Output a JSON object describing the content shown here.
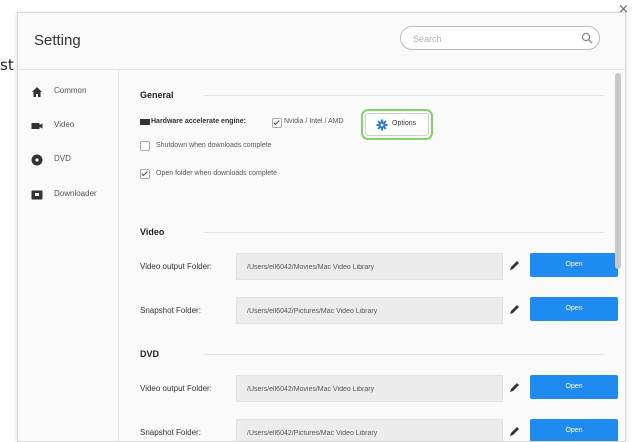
{
  "background": {
    "partial_text": "st"
  },
  "close_glyph": "×",
  "window": {
    "title": "Setting",
    "search": {
      "placeholder": "Search",
      "value": ""
    }
  },
  "sidebar": {
    "items": [
      {
        "label": "Common",
        "icon": "home-icon",
        "selected": true
      },
      {
        "label": "Video",
        "icon": "video-camera-icon",
        "selected": false
      },
      {
        "label": "DVD",
        "icon": "disc-icon",
        "selected": false
      },
      {
        "label": "Downloader",
        "icon": "download-icon",
        "selected": false
      }
    ]
  },
  "general": {
    "title": "General",
    "hw_label": "Hardware accelerate engine:",
    "hw_option": "Nvidia / Intel / AMD",
    "hw_checked": true,
    "options_label": "Options",
    "shutdown_label": "Shutdown when downloads complete",
    "shutdown_checked": false,
    "open_folder_label": "Open folder when downloads complete",
    "open_folder_checked": true
  },
  "video": {
    "title": "Video",
    "output_label": "Video output Folder:",
    "output_path": "/Users/ell6042/Movies/Mac Video Library",
    "snapshot_label": "Snapshot Folder:",
    "snapshot_path": "/Users/ell6042/Pictures/Mac Video Library",
    "open_label": "Open"
  },
  "dvd": {
    "title": "DVD",
    "output_label": "Video output Folder:",
    "output_path": "/Users/ell6042/Movies/Mac Video Library",
    "snapshot_label": "Snapshot Folder:",
    "snapshot_path": "/Users/ell6042/Pictures/Mac Video Library",
    "open_label": "Open"
  },
  "colors": {
    "accent": "#1e8bf0",
    "highlight": "#7fd26a",
    "options_gear": "#2a7fd4"
  }
}
